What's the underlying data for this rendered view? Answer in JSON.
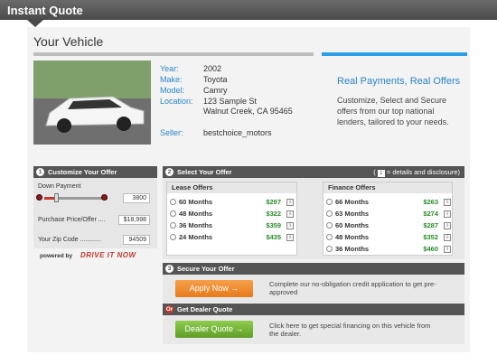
{
  "topbar": {
    "title": "Instant Quote"
  },
  "vehicle": {
    "section_title": "Your Vehicle",
    "year_label": "Year:",
    "year": "2002",
    "make_label": "Make:",
    "make": "Toyota",
    "model_label": "Model:",
    "model": "Camry",
    "location_label": "Location:",
    "location_line1": "123 Sample St",
    "location_line2": "Walnut Creek, CA 95465",
    "seller_label": "Seller:",
    "seller": "bestchoice_motors"
  },
  "promo": {
    "title": "Real Payments, Real Offers",
    "text": "Customize, Select and Secure offers from our top national lenders, tailored to your needs."
  },
  "customize": {
    "step": "1",
    "title": "Customize Your Offer",
    "down_payment_label": "Down Payment",
    "down_payment_value": "3800",
    "down_payment_fraction": 0.2,
    "price_label": "Purchase Price/Offer ....",
    "price_value": "$18,998",
    "zip_label": "Your Zip Code ............",
    "zip_value": "94509",
    "powered_by": "powered by",
    "brand": "DRIVE IT NOW"
  },
  "select": {
    "step": "2",
    "title": "Select Your Offer",
    "disclosure_icon": "1",
    "disclosure_text": "= details and disclosure)",
    "disclosure_open": "(",
    "lease": {
      "title": "Lease Offers",
      "rows": [
        {
          "term": "60 Months",
          "price": "$297"
        },
        {
          "term": "48 Months",
          "price": "$322"
        },
        {
          "term": "36 Months",
          "price": "$359"
        },
        {
          "term": "24 Months",
          "price": "$435"
        }
      ]
    },
    "finance": {
      "title": "Finance Offers",
      "rows": [
        {
          "term": "66 Months",
          "price": "$263"
        },
        {
          "term": "63 Months",
          "price": "$274"
        },
        {
          "term": "60 Months",
          "price": "$287"
        },
        {
          "term": "48 Months",
          "price": "$352"
        },
        {
          "term": "36 Months",
          "price": "$460"
        }
      ]
    }
  },
  "secure": {
    "step": "3",
    "title": "Secure Your Offer",
    "button": "Apply Now",
    "arrow": "→",
    "desc": "Complete our no-obligation credit application to get pre-approved"
  },
  "dealer": {
    "step": "Or",
    "title": "Get Dealer Quote",
    "button": "Dealer Quote",
    "arrow": "→",
    "desc": "Click here to get special financing on this vehicle from the dealer."
  },
  "colors": {
    "accent_blue": "#2a9fe8",
    "header_dark": "#555555",
    "price_green": "#2a8a2a",
    "orange": "#e77a1b",
    "green": "#5f9e27"
  },
  "icons": [
    "info-icon",
    "arrow-right-icon",
    "radio-icon"
  ]
}
